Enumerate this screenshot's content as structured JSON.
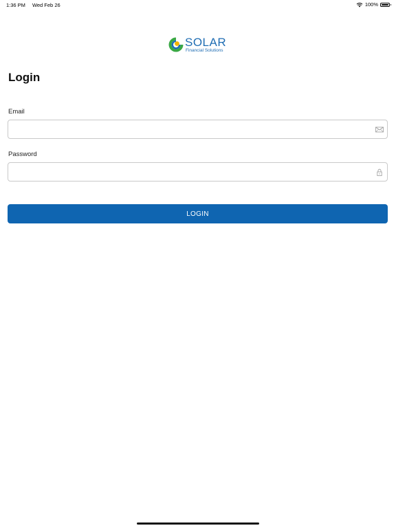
{
  "status_bar": {
    "time": "1:36 PM",
    "date": "Wed Feb 26",
    "battery_percent": "100%",
    "battery_level": 1.0
  },
  "logo": {
    "name": "SOLAR",
    "subtitle": "Financial Solutions",
    "colors": {
      "brand_blue": "#1f6db3",
      "sun_yellow": "#f5b400",
      "leaf_green": "#3aa845"
    }
  },
  "page": {
    "title": "Login"
  },
  "form": {
    "email": {
      "label": "Email",
      "value": "",
      "placeholder": "",
      "icon": "envelope-icon"
    },
    "password": {
      "label": "Password",
      "value": "",
      "placeholder": "",
      "icon": "lock-icon"
    },
    "submit_label": "LOGIN"
  },
  "colors": {
    "accent": "#0f65b1",
    "input_border": "#c9c9c9",
    "background": "#ffffff"
  }
}
